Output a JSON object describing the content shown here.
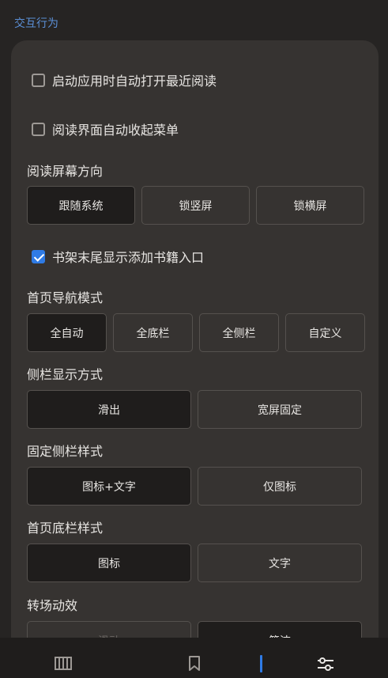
{
  "section_title": "交互行为",
  "checkboxes": [
    {
      "label": "启动应用时自动打开最近阅读",
      "checked": false
    },
    {
      "label": "阅读界面自动收起菜单",
      "checked": false
    },
    {
      "label": "书架末尾显示添加书籍入口",
      "checked": true
    }
  ],
  "reading_orientation": {
    "title": "阅读屏幕方向",
    "options": [
      "跟随系统",
      "锁竖屏",
      "锁横屏"
    ],
    "selected": "跟随系统"
  },
  "home_nav_mode": {
    "title": "首页导航模式",
    "options": [
      "全自动",
      "全底栏",
      "全侧栏",
      "自定义"
    ],
    "selected": "全自动"
  },
  "sidebar_display": {
    "title": "侧栏显示方式",
    "options": [
      "滑出",
      "宽屏固定"
    ],
    "selected": "滑出"
  },
  "fixed_sidebar_style": {
    "title": "固定侧栏样式",
    "options": [
      "图标+文字",
      "仅图标"
    ],
    "selected": "图标+文字"
  },
  "home_bottom_bar_style": {
    "title": "首页底栏样式",
    "options": [
      "图标",
      "文字"
    ],
    "selected": "图标"
  },
  "transition_effect": {
    "title": "转场动效",
    "options": [
      "滑动",
      "简洁"
    ],
    "selected": "简洁"
  },
  "bottom_nav": {
    "items": [
      "bookshelf-icon",
      "bookmark-icon",
      "divider-icon",
      "settings-sliders-icon"
    ],
    "accent_color": "#2f7be5"
  }
}
